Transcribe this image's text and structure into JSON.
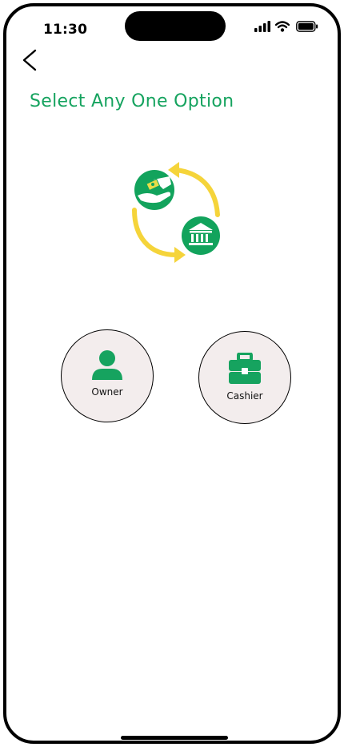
{
  "status_bar": {
    "time": "11:30",
    "icons": [
      "signal-icon",
      "wifi-icon",
      "battery-icon"
    ]
  },
  "nav": {
    "back_icon": "chevron-left-icon"
  },
  "title": "Select Any One Option",
  "options": [
    {
      "label": "Owner",
      "icon": "person-icon"
    },
    {
      "label": "Cashier",
      "icon": "briefcase-icon"
    }
  ],
  "colors": {
    "accent_green": "#16a35f",
    "arrow_yellow": "#f5d43a",
    "option_bg": "#f3eded"
  }
}
